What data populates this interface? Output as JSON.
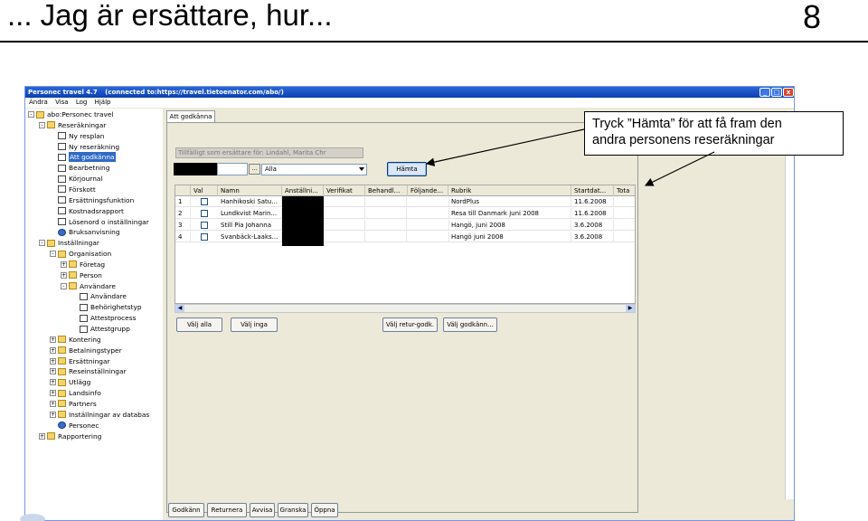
{
  "slide": {
    "title": "... Jag är ersättare, hur...",
    "number": "8"
  },
  "window": {
    "title_parts": [
      "Personec travel 4.7",
      "(connected to:https://travel.tietoenator.com/abo/)"
    ],
    "controls": [
      "_",
      "□",
      "x"
    ],
    "menu": [
      "Ändra",
      "Visa",
      "Log",
      "Hjälp"
    ]
  },
  "tree": {
    "nodes": [
      {
        "label": "abo:Personec travel",
        "icon": "folder-icon",
        "exp": "-"
      },
      {
        "label": "Reseräkningar",
        "icon": "folder-icon",
        "exp": "-"
      },
      {
        "label": "Ny resplan",
        "icon": "document-icon"
      },
      {
        "label": "Ny reseräkning",
        "icon": "document-icon"
      },
      {
        "label": "Att godkänna",
        "icon": "document-icon",
        "selected": true
      },
      {
        "label": "Bearbetning",
        "icon": "document-icon"
      },
      {
        "label": "Körjournal",
        "icon": "document-icon"
      },
      {
        "label": "Förskott",
        "icon": "document-icon"
      },
      {
        "label": "Ersättningsfunktion",
        "icon": "document-icon"
      },
      {
        "label": "Kostnadsrapport",
        "icon": "document-icon"
      },
      {
        "label": "Lösenord o inställningar",
        "icon": "document-icon"
      },
      {
        "label": "Bruksanvisning",
        "icon": "globe-icon"
      },
      {
        "label": "Inställningar",
        "icon": "folder-icon",
        "exp": "-"
      },
      {
        "label": "Organisation",
        "icon": "folder-icon",
        "exp": "-"
      },
      {
        "label": "Företag",
        "icon": "folder-icon",
        "exp": "+"
      },
      {
        "label": "Person",
        "icon": "folder-icon",
        "exp": "+"
      },
      {
        "label": "Användare",
        "icon": "folder-icon",
        "exp": "-"
      },
      {
        "label": "Användare",
        "icon": "document-icon"
      },
      {
        "label": "Behörighetstyp",
        "icon": "document-icon"
      },
      {
        "label": "Attestprocess",
        "icon": "document-icon"
      },
      {
        "label": "Attestgrupp",
        "icon": "document-icon"
      },
      {
        "label": "Kontering",
        "icon": "folder-icon",
        "exp": "+"
      },
      {
        "label": "Betalningstyper",
        "icon": "folder-icon",
        "exp": "+"
      },
      {
        "label": "Ersättningar",
        "icon": "folder-icon",
        "exp": "+"
      },
      {
        "label": "Reseinställningar",
        "icon": "folder-icon",
        "exp": "+"
      },
      {
        "label": "Utlägg",
        "icon": "folder-icon",
        "exp": "+"
      },
      {
        "label": "Landsinfo",
        "icon": "folder-icon",
        "exp": "+"
      },
      {
        "label": "Partners",
        "icon": "folder-icon",
        "exp": "+"
      },
      {
        "label": "Inställningar av databas",
        "icon": "folder-icon",
        "exp": "+"
      },
      {
        "label": "Personec",
        "icon": "globe-icon"
      },
      {
        "label": "Rapportering",
        "icon": "folder-icon",
        "exp": "+"
      }
    ]
  },
  "tab": {
    "label": "Att godkänna"
  },
  "form": {
    "temp_substitute": "Tillfälligt som ersättare för: Lindahl, Marita Chr",
    "dots_button": "...",
    "select_value": "Alla",
    "hamta_button": "Hämta"
  },
  "table": {
    "headers": [
      "",
      "Val",
      "Namn",
      "Anställni...",
      "Verifikat",
      "Behandl...",
      "Följande...",
      "Rubrik",
      "Startdat...",
      "Tota"
    ],
    "rows": [
      {
        "no": "1",
        "namn": "Hanhikoski Satu...",
        "rubrik": "NordPlus",
        "startdat": "11.6.2008"
      },
      {
        "no": "2",
        "namn": "Lundkvist Marin...",
        "rubrik": "Resa till Danmark juni 2008",
        "startdat": "11.6.2008"
      },
      {
        "no": "3",
        "namn": "Still Pia Johanna",
        "rubrik": "Hangö, juni 2008",
        "startdat": "3.6.2008"
      },
      {
        "no": "4",
        "namn": "Svanbäck-Laaks...",
        "rubrik": "Hangö juni 2008",
        "startdat": "3.6.2008"
      }
    ]
  },
  "buttons": {
    "valj_alla": "Välj alla",
    "valj_inga": "Välj inga",
    "valj_retur": "Välj retur-godk.",
    "valj_godkann": "Välj godkänn..."
  },
  "bottom_buttons": [
    "Godkänn",
    "Returnera",
    "Avvisa",
    "Granska",
    "Öppna"
  ],
  "callout": {
    "line1": "Tryck ”Hämta” för att få fram den",
    "line2": "andra personens reseräkningar"
  }
}
